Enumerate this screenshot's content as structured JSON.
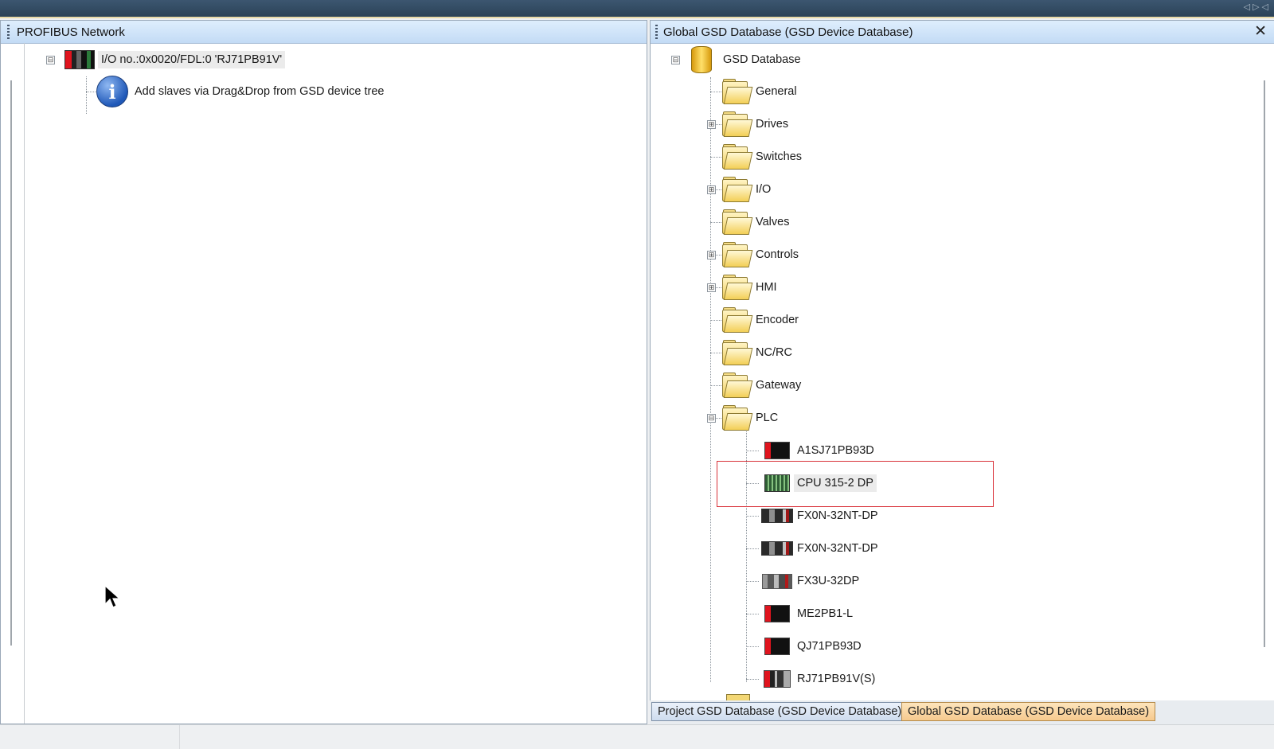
{
  "left_pane": {
    "title": "PROFIBUS Network",
    "master_label": "I/O no.:0x0020/FDL:0 'RJ71PB91V'",
    "info_text": "Add slaves via Drag&Drop from GSD device tree"
  },
  "right_pane": {
    "title": "Global GSD Database (GSD Device Database)",
    "close_glyph": "✕",
    "root_label": "GSD Database",
    "folders": [
      "General",
      "Drives",
      "Switches",
      "I/O",
      "Valves",
      "Controls",
      "HMI",
      "Encoder",
      "NC/RC",
      "Gateway",
      "PLC"
    ],
    "plc_devices": [
      "A1SJ71PB93D",
      "CPU 315-2 DP",
      "FX0N-32NT-DP",
      "FX0N-32NT-DP",
      "FX3U-32DP",
      "ME2PB1-L",
      "QJ71PB93D",
      "RJ71PB91V(S)"
    ],
    "highlighted_device": "CPU 315-2 DP"
  },
  "tabs": {
    "project": "Project GSD Database (GSD Device Database)",
    "global": "Global GSD Database (GSD Device Database)",
    "active": "global"
  },
  "icons": {
    "collapse": "⊟",
    "expand": "⊞",
    "info": "i"
  }
}
